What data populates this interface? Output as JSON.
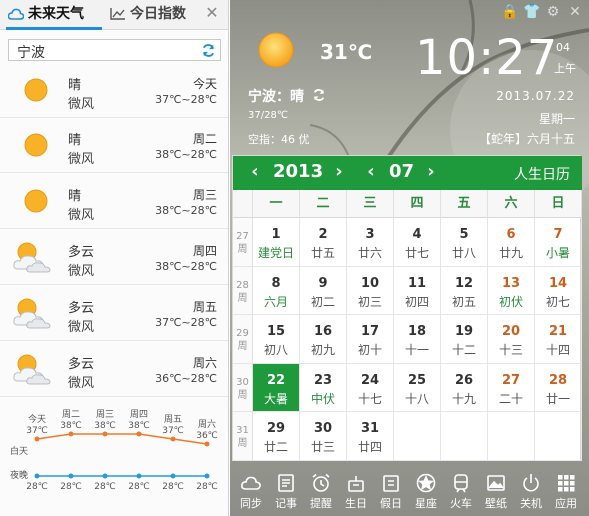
{
  "left_panel": {
    "tabs": [
      {
        "label": "未来天气",
        "active": true
      },
      {
        "label": "今日指数",
        "active": false
      }
    ],
    "city": "宁波",
    "days": [
      {
        "condition": "晴",
        "wind": "微风",
        "day": "今天",
        "temp": "37℃~28℃",
        "icon": "sun-icon"
      },
      {
        "condition": "晴",
        "wind": "微风",
        "day": "周二",
        "temp": "38℃~28℃",
        "icon": "sun-icon"
      },
      {
        "condition": "晴",
        "wind": "微风",
        "day": "周三",
        "temp": "38℃~28℃",
        "icon": "sun-icon"
      },
      {
        "condition": "多云",
        "wind": "微风",
        "day": "周四",
        "temp": "38℃~28℃",
        "icon": "cloudy-icon"
      },
      {
        "condition": "多云",
        "wind": "微风",
        "day": "周五",
        "temp": "37℃~28℃",
        "icon": "cloudy-icon"
      },
      {
        "condition": "多云",
        "wind": "微风",
        "day": "周六",
        "temp": "36℃~28℃",
        "icon": "cloudy-icon"
      }
    ],
    "trend": {
      "day_label": "白天",
      "night_label": "夜晚",
      "days": [
        "今天",
        "周二",
        "周三",
        "周四",
        "周五",
        "周六"
      ],
      "high": [
        37,
        38,
        38,
        38,
        37,
        36
      ],
      "low": [
        28,
        28,
        28,
        28,
        28,
        28
      ],
      "high_labels": [
        "37℃",
        "38℃",
        "38℃",
        "38℃",
        "37℃",
        "36℃"
      ],
      "low_labels": [
        "28℃",
        "28℃",
        "28℃",
        "28℃",
        "28℃",
        "28℃"
      ],
      "high_color": "#f07a2a",
      "low_color": "#2a9ad8"
    }
  },
  "right_panel": {
    "current": {
      "temp": "31℃",
      "location_condition": "宁波：晴",
      "range": "37/28℃",
      "aqi": "空指：46 优"
    },
    "clock": {
      "time": "10:27",
      "seconds": "04",
      "ampm": "上午",
      "date": "2013.07.22",
      "weekday": "星期一",
      "lunar": "【蛇年】六月十五"
    },
    "calendar": {
      "year": "2013",
      "month": "07",
      "almanac_label": "人生日历",
      "weekday_headers": [
        "一",
        "二",
        "三",
        "四",
        "五",
        "六",
        "日"
      ],
      "week_suffix": "周",
      "weeks": [
        {
          "num": "27",
          "days": [
            {
              "d": "1",
              "l": "建党日",
              "hl": true
            },
            {
              "d": "2",
              "l": "廿五"
            },
            {
              "d": "3",
              "l": "廿六"
            },
            {
              "d": "4",
              "l": "廿七"
            },
            {
              "d": "5",
              "l": "廿八"
            },
            {
              "d": "6",
              "l": "廿九",
              "we": true
            },
            {
              "d": "7",
              "l": "小暑",
              "we": true,
              "hl": true
            }
          ]
        },
        {
          "num": "28",
          "days": [
            {
              "d": "8",
              "l": "六月",
              "hl": true
            },
            {
              "d": "9",
              "l": "初二"
            },
            {
              "d": "10",
              "l": "初三"
            },
            {
              "d": "11",
              "l": "初四"
            },
            {
              "d": "12",
              "l": "初五"
            },
            {
              "d": "13",
              "l": "初伏",
              "we": true,
              "hl": true
            },
            {
              "d": "14",
              "l": "初七",
              "we": true
            }
          ]
        },
        {
          "num": "29",
          "days": [
            {
              "d": "15",
              "l": "初八"
            },
            {
              "d": "16",
              "l": "初九"
            },
            {
              "d": "17",
              "l": "初十"
            },
            {
              "d": "18",
              "l": "十一"
            },
            {
              "d": "19",
              "l": "十二"
            },
            {
              "d": "20",
              "l": "十三",
              "we": true
            },
            {
              "d": "21",
              "l": "十四",
              "we": true
            }
          ]
        },
        {
          "num": "30",
          "days": [
            {
              "d": "22",
              "l": "大暑",
              "today": true
            },
            {
              "d": "23",
              "l": "中伏",
              "hl": true
            },
            {
              "d": "24",
              "l": "十七"
            },
            {
              "d": "25",
              "l": "十八"
            },
            {
              "d": "26",
              "l": "十九"
            },
            {
              "d": "27",
              "l": "二十",
              "we": true
            },
            {
              "d": "28",
              "l": "廿一",
              "we": true
            }
          ]
        },
        {
          "num": "31",
          "days": [
            {
              "d": "29",
              "l": "廿二"
            },
            {
              "d": "30",
              "l": "廿三"
            },
            {
              "d": "31",
              "l": "廿四"
            },
            {
              "d": "",
              "l": ""
            },
            {
              "d": "",
              "l": ""
            },
            {
              "d": "",
              "l": ""
            },
            {
              "d": "",
              "l": ""
            }
          ]
        }
      ]
    },
    "toolbar": [
      {
        "label": "同步",
        "icon": "cloud-sync-icon"
      },
      {
        "label": "记事",
        "icon": "notes-icon"
      },
      {
        "label": "提醒",
        "icon": "alarm-icon"
      },
      {
        "label": "生日",
        "icon": "birthday-icon"
      },
      {
        "label": "假日",
        "icon": "holiday-icon"
      },
      {
        "label": "星座",
        "icon": "star-icon"
      },
      {
        "label": "火车",
        "icon": "train-icon"
      },
      {
        "label": "壁纸",
        "icon": "wallpaper-icon"
      },
      {
        "label": "关机",
        "icon": "power-icon"
      },
      {
        "label": "应用",
        "icon": "apps-icon"
      }
    ],
    "colors": {
      "calendar_green": "#1e9a3c",
      "weekend_orange": "#c8601e"
    }
  }
}
